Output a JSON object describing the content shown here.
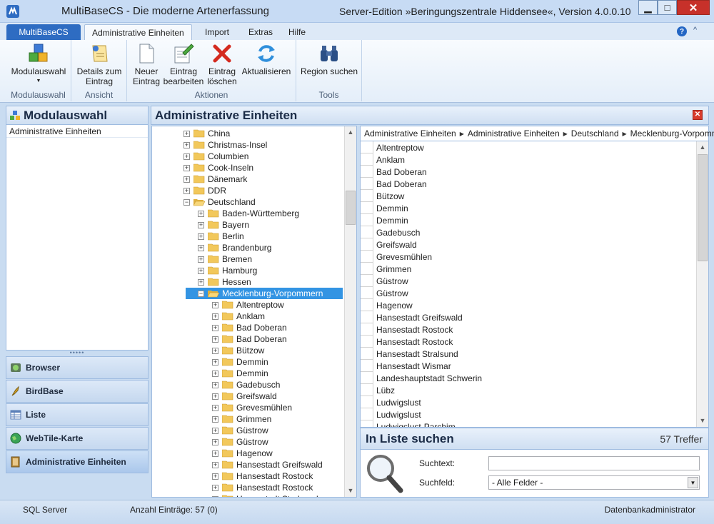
{
  "window": {
    "title": "MultiBaseCS - Die moderne Artenerfassung",
    "edition": "Server-Edition »Beringungszentrale Hiddensee«, Version 4.0.0.10",
    "minimize": "▁",
    "maximize": "□",
    "close": "✕"
  },
  "ribbon": {
    "app_tab": "MultiBaseCS",
    "tabs": [
      "Administrative Einheiten",
      "Import",
      "Extras",
      "Hilfe"
    ],
    "help_glyph": "?",
    "collapse_glyph": "^",
    "groups": [
      {
        "label": "Modulauswahl",
        "buttons": [
          {
            "label": "Modulauswahl",
            "icon": "modules-icon"
          }
        ]
      },
      {
        "label": "Ansicht",
        "buttons": [
          {
            "label": "Details zum Eintrag",
            "icon": "details-icon"
          }
        ]
      },
      {
        "label": "Aktionen",
        "buttons": [
          {
            "label": "Neuer Eintrag",
            "icon": "new-entry-icon"
          },
          {
            "label": "Eintrag bearbeiten",
            "icon": "edit-entry-icon"
          },
          {
            "label": "Eintrag löschen",
            "icon": "delete-icon"
          },
          {
            "label": "Aktualisieren",
            "icon": "refresh-icon"
          }
        ]
      },
      {
        "label": "Tools",
        "buttons": [
          {
            "label": "Region suchen",
            "icon": "binoculars-icon"
          }
        ]
      }
    ]
  },
  "left_pane": {
    "title": "Modulauswahl",
    "modules": [
      "Administrative Einheiten"
    ],
    "grip": "•••••",
    "nav": [
      {
        "label": "Browser",
        "icon": "globe-icon",
        "active": false
      },
      {
        "label": "BirdBase",
        "icon": "bird-icon",
        "active": false
      },
      {
        "label": "Liste",
        "icon": "table-icon",
        "active": false
      },
      {
        "label": "WebTile-Karte",
        "icon": "map-globe-icon",
        "active": false
      },
      {
        "label": "Administrative Einheiten",
        "icon": "book-icon",
        "active": true
      }
    ]
  },
  "main": {
    "title": "Administrative Einheiten",
    "close_glyph": "✕",
    "tree": [
      {
        "label": "China",
        "level": 0,
        "expanded": false
      },
      {
        "label": "Christmas-Insel",
        "level": 0,
        "expanded": false
      },
      {
        "label": "Columbien",
        "level": 0,
        "expanded": false
      },
      {
        "label": "Cook-Inseln",
        "level": 0,
        "expanded": false
      },
      {
        "label": "Dänemark",
        "level": 0,
        "expanded": false
      },
      {
        "label": "DDR",
        "level": 0,
        "expanded": false
      },
      {
        "label": "Deutschland",
        "level": 0,
        "expanded": true
      },
      {
        "label": "Baden-Württemberg",
        "level": 1,
        "expanded": false
      },
      {
        "label": "Bayern",
        "level": 1,
        "expanded": false
      },
      {
        "label": "Berlin",
        "level": 1,
        "expanded": false
      },
      {
        "label": "Brandenburg",
        "level": 1,
        "expanded": false
      },
      {
        "label": "Bremen",
        "level": 1,
        "expanded": false
      },
      {
        "label": "Hamburg",
        "level": 1,
        "expanded": false
      },
      {
        "label": "Hessen",
        "level": 1,
        "expanded": false
      },
      {
        "label": "Mecklenburg-Vorpommern",
        "level": 1,
        "expanded": true,
        "selected": true
      },
      {
        "label": "Altentreptow",
        "level": 2,
        "expanded": false
      },
      {
        "label": "Anklam",
        "level": 2,
        "expanded": false
      },
      {
        "label": "Bad Doberan",
        "level": 2,
        "expanded": false
      },
      {
        "label": "Bad Doberan",
        "level": 2,
        "expanded": false
      },
      {
        "label": "Bützow",
        "level": 2,
        "expanded": false
      },
      {
        "label": "Demmin",
        "level": 2,
        "expanded": false
      },
      {
        "label": "Demmin",
        "level": 2,
        "expanded": false
      },
      {
        "label": "Gadebusch",
        "level": 2,
        "expanded": false
      },
      {
        "label": "Greifswald",
        "level": 2,
        "expanded": false
      },
      {
        "label": "Grevesmühlen",
        "level": 2,
        "expanded": false
      },
      {
        "label": "Grimmen",
        "level": 2,
        "expanded": false
      },
      {
        "label": "Güstrow",
        "level": 2,
        "expanded": false
      },
      {
        "label": "Güstrow",
        "level": 2,
        "expanded": false
      },
      {
        "label": "Hagenow",
        "level": 2,
        "expanded": false
      },
      {
        "label": "Hansestadt Greifswald",
        "level": 2,
        "expanded": false
      },
      {
        "label": "Hansestadt Rostock",
        "level": 2,
        "expanded": false
      },
      {
        "label": "Hansestadt Rostock",
        "level": 2,
        "expanded": false
      },
      {
        "label": "Hansestadt Stralsund",
        "level": 2,
        "expanded": false
      }
    ],
    "breadcrumb": [
      "Administrative Einheiten",
      "Administrative Einheiten",
      "Deutschland",
      "Mecklenburg-Vorpommern"
    ],
    "breadcrumb_sep": "▶",
    "list": [
      "Altentreptow",
      "Anklam",
      "Bad Doberan",
      "Bad Doberan",
      "Bützow",
      "Demmin",
      "Demmin",
      "Gadebusch",
      "Greifswald",
      "Grevesmühlen",
      "Grimmen",
      "Güstrow",
      "Güstrow",
      "Hagenow",
      "Hansestadt Greifswald",
      "Hansestadt Rostock",
      "Hansestadt Rostock",
      "Hansestadt Stralsund",
      "Hansestadt Wismar",
      "Landeshauptstadt Schwerin",
      "Lübz",
      "Ludwigslust",
      "Ludwigslust",
      "Ludwigslust-Parchim"
    ],
    "search": {
      "title": "In Liste suchen",
      "hits": "57 Treffer",
      "text_label": "Suchtext:",
      "text_value": "",
      "field_label": "Suchfeld:",
      "field_value": "- Alle Felder -",
      "dropdown_glyph": "▼"
    },
    "scroll_up": "▲",
    "scroll_down": "▼"
  },
  "status": {
    "db": "SQL Server",
    "count": "Anzahl Einträge: 57 (0)",
    "user": "Datenbankadministrator"
  },
  "colors": {
    "accent": "#2e6cc2",
    "selection": "#3394e3",
    "close": "#c7312a",
    "folder": "#f2c85b"
  }
}
